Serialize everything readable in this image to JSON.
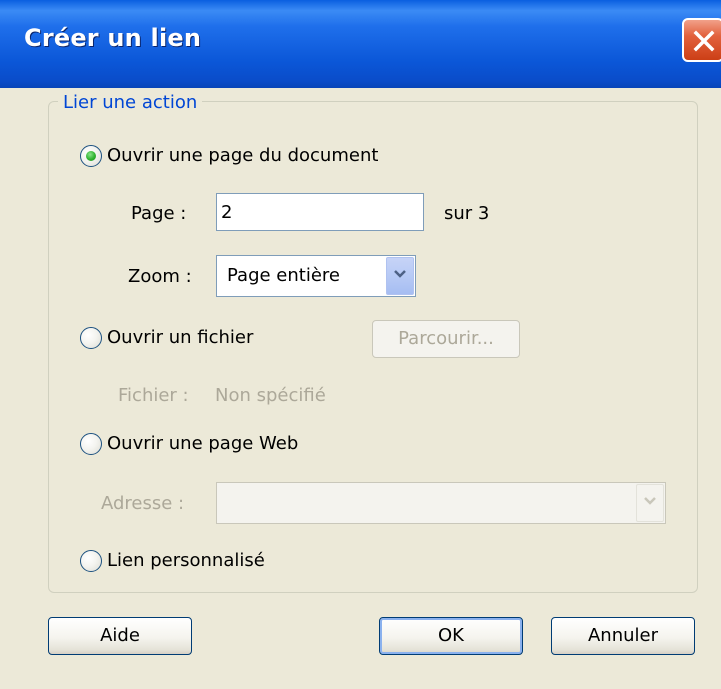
{
  "window": {
    "title": "Créer un lien"
  },
  "group": {
    "legend": "Lier une action"
  },
  "options": {
    "page": {
      "label": "Ouvrir une page du document",
      "checked": true
    },
    "file": {
      "label": "Ouvrir un fichier",
      "checked": false
    },
    "web": {
      "label": "Ouvrir une page Web",
      "checked": false
    },
    "custom": {
      "label": "Lien personnalisé",
      "checked": false
    }
  },
  "page_section": {
    "page_label": "Page :",
    "page_value": "2",
    "page_total": "sur 3",
    "zoom_label": "Zoom :",
    "zoom_value": "Page entière"
  },
  "file_section": {
    "browse_label": "Parcourir...",
    "file_label": "Fichier :",
    "file_value": "Non spécifié"
  },
  "web_section": {
    "address_label": "Adresse :",
    "address_value": ""
  },
  "buttons": {
    "help": "Aide",
    "ok": "OK",
    "cancel": "Annuler"
  },
  "icons": {
    "close": "close-icon",
    "dropdown": "chevron-down-icon"
  },
  "colors": {
    "titlebar": "#0B57D8",
    "dialog_bg": "#ECE9D8",
    "legend_text": "#0046D5",
    "disabled_text": "#ACA899",
    "close_button": "#E2613D"
  }
}
